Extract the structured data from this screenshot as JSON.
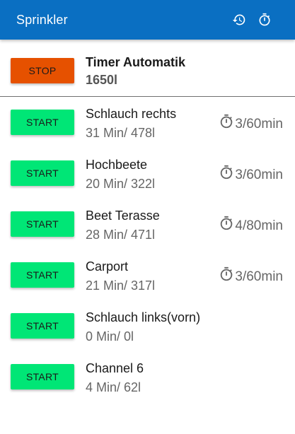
{
  "appbar": {
    "title": "Sprinkler",
    "icons": [
      "history-icon",
      "timer-icon"
    ]
  },
  "automatic": {
    "button_label": "STOP",
    "name": "Timer Automatik",
    "volume": "1650l"
  },
  "channels": [
    {
      "button_label": "START",
      "name": "Schlauch rechts",
      "info": "31 Min/ 478l",
      "schedule": "3/60min"
    },
    {
      "button_label": "START",
      "name": "Hochbeete",
      "info": "20 Min/ 322l",
      "schedule": "3/60min"
    },
    {
      "button_label": "START",
      "name": "Beet Terasse",
      "info": "28 Min/ 471l",
      "schedule": "4/80min"
    },
    {
      "button_label": "START",
      "name": "Carport",
      "info": "21 Min/ 317l",
      "schedule": "3/60min"
    },
    {
      "button_label": "START",
      "name": "Schlauch links(vorn)",
      "info": "0 Min/ 0l"
    },
    {
      "button_label": "START",
      "name": "Channel 6",
      "info": "4 Min/ 62l"
    }
  ],
  "colors": {
    "appbar": "#0a6fc2",
    "start_button": "#00e676",
    "stop_button": "#e65100"
  }
}
